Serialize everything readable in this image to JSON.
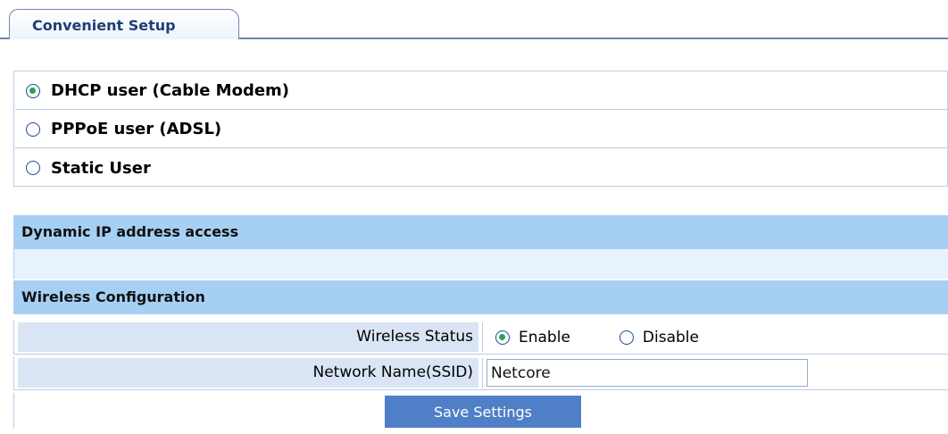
{
  "tab": {
    "label": "Convenient Setup"
  },
  "connection_modes": [
    {
      "label": "DHCP user (Cable Modem)",
      "selected": true
    },
    {
      "label": "PPPoE user (ADSL)",
      "selected": false
    },
    {
      "label": "Static User",
      "selected": false
    }
  ],
  "sections": {
    "dynamic_ip": "Dynamic IP address access",
    "wireless": "Wireless Configuration"
  },
  "wireless": {
    "status_label": "Wireless Status",
    "enable_label": "Enable",
    "disable_label": "Disable",
    "status_value": "Enable",
    "ssid_label": "Network Name(SSID)",
    "ssid_value": "Netcore"
  },
  "buttons": {
    "save": "Save Settings"
  },
  "colors": {
    "section_header": "#a6cff4",
    "label_cell": "#d9e5f5",
    "button": "#4f7fc6",
    "radio_dot": "#2aa34a"
  }
}
